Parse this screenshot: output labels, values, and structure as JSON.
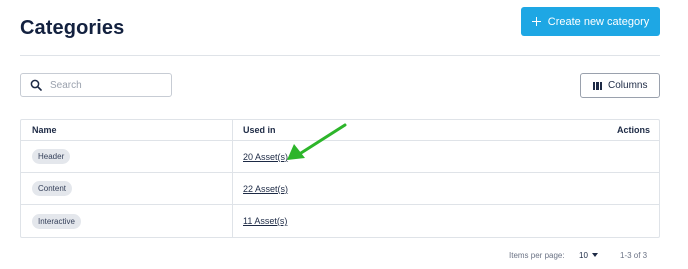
{
  "header": {
    "title": "Categories",
    "create_button": {
      "label": "Create new category",
      "icon": "plus-icon"
    }
  },
  "toolbar": {
    "search": {
      "placeholder": "Search",
      "value": "",
      "icon": "search-icon"
    },
    "columns_button": {
      "label": "Columns",
      "icon": "columns-icon"
    }
  },
  "table": {
    "headers": {
      "name": "Name",
      "used_in": "Used in",
      "actions": "Actions"
    },
    "rows": [
      {
        "name": "Header",
        "used_in": "20 Asset(s)"
      },
      {
        "name": "Content",
        "used_in": "22 Asset(s)"
      },
      {
        "name": "Interactive",
        "used_in": "11 Asset(s)"
      }
    ]
  },
  "pagination": {
    "items_per_page_label": "Items per page:",
    "items_per_page_value": "10",
    "range": "1-3 of 3"
  },
  "colors": {
    "primary": "#1ea7e4",
    "title": "#13213f",
    "annotation_arrow": "#2db52a"
  }
}
